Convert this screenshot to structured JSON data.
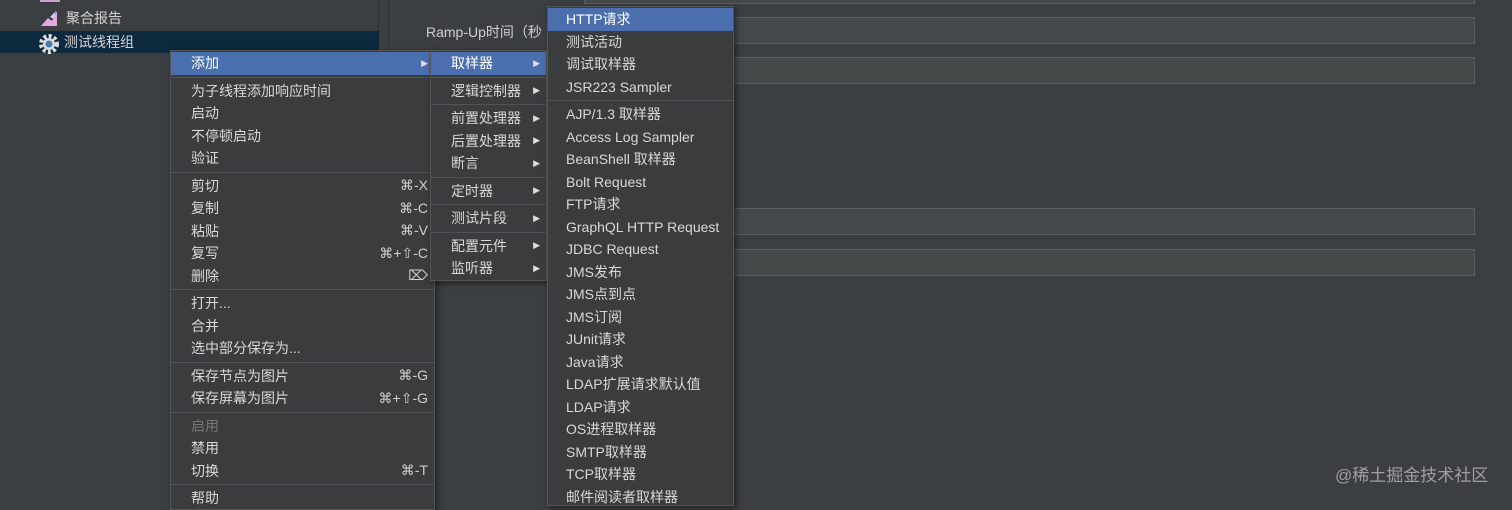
{
  "tree": {
    "items": [
      {
        "label": "聚合报告",
        "icon": "aggregate-report-icon"
      },
      {
        "label": "测试线程组",
        "icon": "gear-icon",
        "selected": true
      }
    ]
  },
  "form": {
    "rampup_label": "Ramp-Up时间（秒"
  },
  "menu_main": [
    {
      "label": "添加",
      "submenu": true,
      "highlight": true
    },
    {
      "sep": true
    },
    {
      "label": "为子线程添加响应时间"
    },
    {
      "label": "启动"
    },
    {
      "label": "不停顿启动"
    },
    {
      "label": "验证"
    },
    {
      "sep": true
    },
    {
      "label": "剪切",
      "shortcut": "⌘-X"
    },
    {
      "label": "复制",
      "shortcut": "⌘-C"
    },
    {
      "label": "粘贴",
      "shortcut": "⌘-V"
    },
    {
      "label": "复写",
      "shortcut": "⌘+⇧-C"
    },
    {
      "label": "删除",
      "shortcut": "⌦"
    },
    {
      "sep": true
    },
    {
      "label": "打开..."
    },
    {
      "label": "合并"
    },
    {
      "label": "选中部分保存为..."
    },
    {
      "sep": true
    },
    {
      "label": "保存节点为图片",
      "shortcut": "⌘-G"
    },
    {
      "label": "保存屏幕为图片",
      "shortcut": "⌘+⇧-G"
    },
    {
      "sep": true
    },
    {
      "label": "启用",
      "disabled": true
    },
    {
      "label": "禁用"
    },
    {
      "label": "切换",
      "shortcut": "⌘-T"
    },
    {
      "sep": true
    },
    {
      "label": "帮助"
    }
  ],
  "menu_add": [
    {
      "label": "取样器",
      "submenu": true,
      "highlight": true
    },
    {
      "sep": true
    },
    {
      "label": "逻辑控制器",
      "submenu": true
    },
    {
      "sep": true
    },
    {
      "label": "前置处理器",
      "submenu": true
    },
    {
      "label": "后置处理器",
      "submenu": true
    },
    {
      "label": "断言",
      "submenu": true
    },
    {
      "sep": true
    },
    {
      "label": "定时器",
      "submenu": true
    },
    {
      "sep": true
    },
    {
      "label": "测试片段",
      "submenu": true
    },
    {
      "sep": true
    },
    {
      "label": "配置元件",
      "submenu": true
    },
    {
      "label": "监听器",
      "submenu": true
    }
  ],
  "menu_sampler": [
    {
      "label": "HTTP请求",
      "highlight": true
    },
    {
      "label": "测试活动"
    },
    {
      "label": "调试取样器"
    },
    {
      "label": "JSR223 Sampler"
    },
    {
      "sep": true
    },
    {
      "label": "AJP/1.3 取样器"
    },
    {
      "label": "Access Log Sampler"
    },
    {
      "label": "BeanShell 取样器"
    },
    {
      "label": "Bolt Request"
    },
    {
      "label": "FTP请求"
    },
    {
      "label": "GraphQL HTTP Request"
    },
    {
      "label": "JDBC Request"
    },
    {
      "label": "JMS发布"
    },
    {
      "label": "JMS点到点"
    },
    {
      "label": "JMS订阅"
    },
    {
      "label": "JUnit请求"
    },
    {
      "label": "Java请求"
    },
    {
      "label": "LDAP扩展请求默认值"
    },
    {
      "label": "LDAP请求"
    },
    {
      "label": "OS进程取样器"
    },
    {
      "label": "SMTP取样器"
    },
    {
      "label": "TCP取样器"
    },
    {
      "label": "邮件阅读者取样器"
    }
  ],
  "watermark": "@稀土掘金技术社区"
}
